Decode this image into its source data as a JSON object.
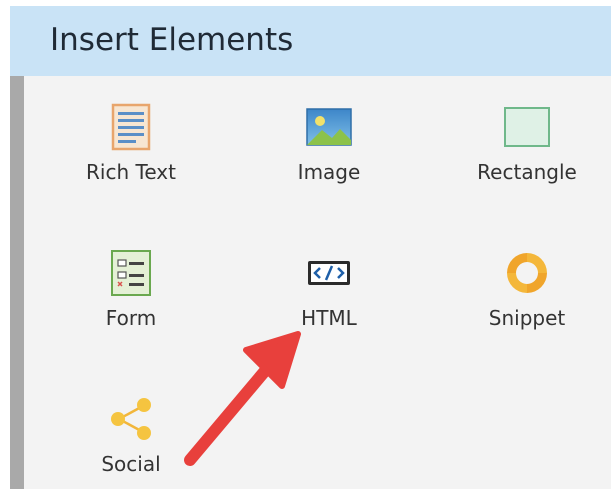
{
  "header": {
    "title": "Insert Elements"
  },
  "elements": [
    {
      "label": "Rich Text",
      "icon": "rich-text-icon"
    },
    {
      "label": "Image",
      "icon": "image-icon"
    },
    {
      "label": "Rectangle",
      "icon": "rectangle-icon"
    },
    {
      "label": "Form",
      "icon": "form-icon"
    },
    {
      "label": "HTML",
      "icon": "html-icon"
    },
    {
      "label": "Snippet",
      "icon": "snippet-icon"
    },
    {
      "label": "Social",
      "icon": "social-icon"
    }
  ],
  "colors": {
    "header_bg": "#c9e3f6",
    "panel_bg": "#f3f3f3",
    "arrow": "#e8403c"
  }
}
